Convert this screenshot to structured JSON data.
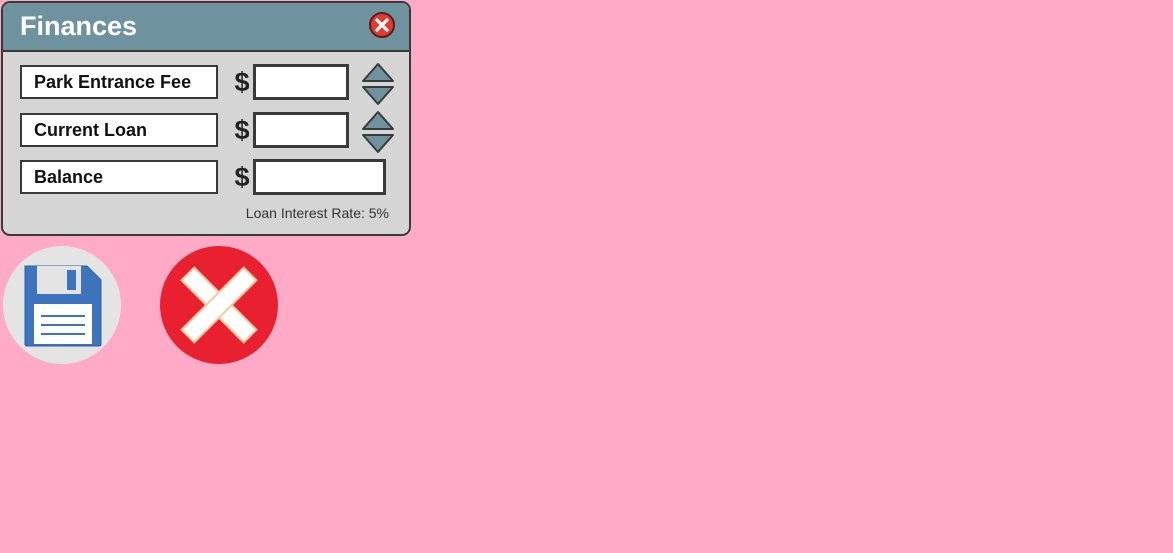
{
  "window": {
    "title": "Finances",
    "close_icon": "close-icon"
  },
  "rows": [
    {
      "label": "Park Entrance Fee",
      "currency": "$",
      "value": "",
      "has_stepper": true
    },
    {
      "label": "Current Loan",
      "currency": "$",
      "value": "",
      "has_stepper": true
    },
    {
      "label": "Balance",
      "currency": "$",
      "value": "",
      "has_stepper": false
    }
  ],
  "note": "Loan Interest Rate: 5%",
  "actions": {
    "save_icon": "floppy-disk-icon",
    "cancel_icon": "x-icon"
  },
  "colors": {
    "background": "#ffabc7",
    "titlebar": "#6e939e",
    "panel": "#d5d5d5",
    "close_red": "#e23a33",
    "save_blue": "#3e74bd",
    "cancel_red": "#e8202f"
  }
}
